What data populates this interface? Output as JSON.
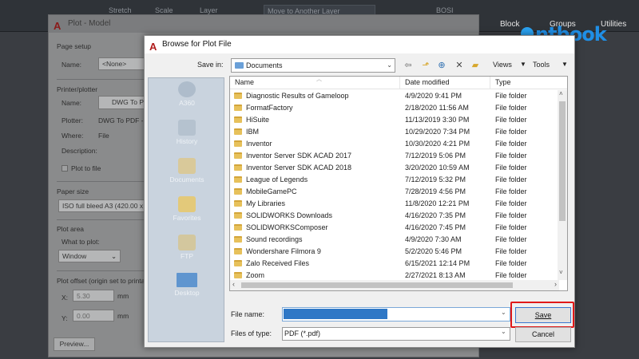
{
  "ribbon": {
    "move_label": "Move to Another Layer",
    "stretch_label": "Stretch",
    "scale_label": "Scale",
    "layer_label": "Layer",
    "bosi_label": "BOSI",
    "block_label": "Block",
    "groups_label": "Groups",
    "utilities_label": "Utilities"
  },
  "watermark": "ntbook",
  "plot_dialog": {
    "title": "Plot - Model",
    "page_setup": "Page setup",
    "name_label": "Name:",
    "name_value": "<None>",
    "printer_plotter": "Printer/plotter",
    "printer_name_label": "Name:",
    "printer_name_value": "DWG To P",
    "plotter_label": "Plotter:",
    "plotter_value": "DWG To PDF - I",
    "where_label": "Where:",
    "where_value": "File",
    "description_label": "Description:",
    "plot_to_file": "Plot to file",
    "paper_size": "Paper size",
    "paper_value": "ISO full bleed A3 (420.00 x 2",
    "plot_area": "Plot area",
    "what_to_plot": "What to plot:",
    "what_value": "Window",
    "plot_offset": "Plot offset (origin set to printa",
    "x_label": "X:",
    "x_value": "5.30",
    "y_label": "Y:",
    "y_value": "0.00",
    "unit": "mm",
    "preview_button": "Preview..."
  },
  "browse_dialog": {
    "title": "Browse for Plot File",
    "save_in_label": "Save in:",
    "save_in_value": "Documents",
    "views_label": "Views",
    "tools_label": "Tools",
    "places": [
      "A360",
      "History",
      "Documents",
      "Favorites",
      "FTP",
      "Desktop"
    ],
    "columns": {
      "name": "Name",
      "date": "Date modified",
      "type": "Type"
    },
    "files": [
      {
        "name": "Diagnostic Results of Gameloop",
        "date": "4/9/2020 9:41 PM",
        "type": "File folder"
      },
      {
        "name": "FormatFactory",
        "date": "2/18/2020 11:56 AM",
        "type": "File folder"
      },
      {
        "name": "HiSuite",
        "date": "11/13/2019 3:30 PM",
        "type": "File folder"
      },
      {
        "name": "IBM",
        "date": "10/29/2020 7:34 PM",
        "type": "File folder"
      },
      {
        "name": "Inventor",
        "date": "10/30/2020 4:21 PM",
        "type": "File folder"
      },
      {
        "name": "Inventor Server SDK ACAD 2017",
        "date": "7/12/2019 5:06 PM",
        "type": "File folder"
      },
      {
        "name": "Inventor Server SDK ACAD 2018",
        "date": "3/20/2020 10:59 AM",
        "type": "File folder"
      },
      {
        "name": "League of Legends",
        "date": "7/12/2019 5:32 PM",
        "type": "File folder"
      },
      {
        "name": "MobileGamePC",
        "date": "7/28/2019 4:56 PM",
        "type": "File folder"
      },
      {
        "name": "My Libraries",
        "date": "11/8/2020 12:21 PM",
        "type": "File folder"
      },
      {
        "name": "SOLIDWORKS Downloads",
        "date": "4/16/2020 7:35 PM",
        "type": "File folder"
      },
      {
        "name": "SOLIDWORKSComposer",
        "date": "4/16/2020 7:45 PM",
        "type": "File folder"
      },
      {
        "name": "Sound recordings",
        "date": "4/9/2020 7:30 AM",
        "type": "File folder"
      },
      {
        "name": "Wondershare Filmora 9",
        "date": "5/2/2020 5:46 PM",
        "type": "File folder"
      },
      {
        "name": "Zalo Received Files",
        "date": "6/15/2021 12:14 PM",
        "type": "File folder"
      },
      {
        "name": "Zoom",
        "date": "2/27/2021 8:13 AM",
        "type": "File folder"
      }
    ],
    "file_name_label": "File name:",
    "file_name_value": "",
    "files_of_type_label": "Files of type:",
    "files_of_type_value": "PDF (*.pdf)",
    "save_button": "Save",
    "cancel_button": "Cancel"
  },
  "colors": {
    "highlight": "#e01818",
    "selection": "#2f78c6",
    "watermark": "#1f8fe6"
  }
}
